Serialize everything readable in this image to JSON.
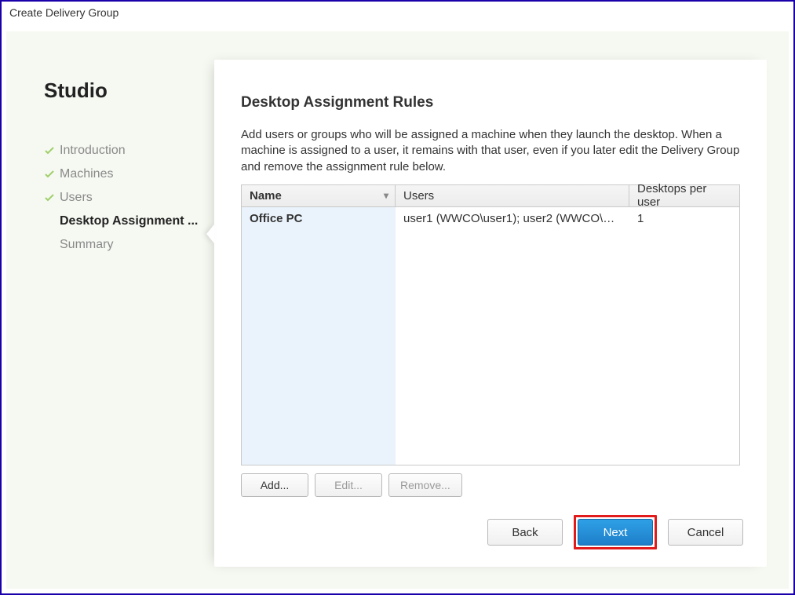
{
  "window": {
    "title": "Create Delivery Group"
  },
  "sidebar": {
    "brand": "Studio",
    "steps": [
      {
        "label": "Introduction",
        "done": true
      },
      {
        "label": "Machines",
        "done": true
      },
      {
        "label": "Users",
        "done": true
      },
      {
        "label": "Desktop Assignment ...",
        "current": true
      },
      {
        "label": "Summary"
      }
    ]
  },
  "main": {
    "heading": "Desktop Assignment Rules",
    "description": "Add users or groups who will be assigned a machine when they launch the desktop. When a machine is assigned to a user, it remains with that user, even if you later edit the Delivery Group and remove the assignment rule below.",
    "columns": {
      "name": "Name",
      "users": "Users",
      "dpu": "Desktops per user"
    },
    "rows": [
      {
        "name": "Office PC",
        "users": "user1 (WWCO\\user1); user2 (WWCO\\us...",
        "dpu": "1"
      }
    ],
    "buttons": {
      "add": "Add...",
      "edit": "Edit...",
      "remove": "Remove..."
    }
  },
  "wizard": {
    "back": "Back",
    "next": "Next",
    "cancel": "Cancel"
  }
}
